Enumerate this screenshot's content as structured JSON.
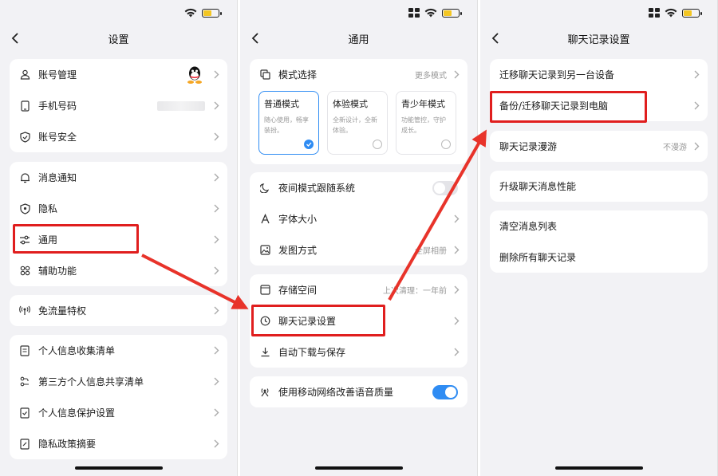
{
  "panel1": {
    "title": "设置",
    "group1": [
      {
        "label": "账号管理",
        "icon": "user-icon"
      },
      {
        "label": "手机号码",
        "icon": "phone-icon"
      },
      {
        "label": "账号安全",
        "icon": "shield-icon"
      }
    ],
    "group2": [
      {
        "label": "消息通知",
        "icon": "bell-icon"
      },
      {
        "label": "隐私",
        "icon": "privacy-icon"
      },
      {
        "label": "通用",
        "icon": "sliders-icon"
      },
      {
        "label": "辅助功能",
        "icon": "grid-icon"
      }
    ],
    "group3": [
      {
        "label": "免流量特权",
        "icon": "signal-icon"
      }
    ],
    "group4": [
      {
        "label": "个人信息收集清单",
        "icon": "document-icon"
      },
      {
        "label": "第三方个人信息共享清单",
        "icon": "share-icon"
      },
      {
        "label": "个人信息保护设置",
        "icon": "check-doc-icon"
      },
      {
        "label": "隐私政策摘要",
        "icon": "policy-icon"
      }
    ]
  },
  "panel2": {
    "title": "通用",
    "mode_select": "模式选择",
    "more_modes": "更多模式",
    "modes": [
      {
        "name": "普通模式",
        "desc": "随心使用，畅享装扮。",
        "selected": true
      },
      {
        "name": "体验模式",
        "desc": "全新设计，全新体验。",
        "selected": false
      },
      {
        "name": "青少年模式",
        "desc": "功能管控，守护成长。",
        "selected": false
      }
    ],
    "group2": [
      {
        "label": "夜间模式跟随系统",
        "icon": "moon-icon",
        "toggle": false
      },
      {
        "label": "字体大小",
        "icon": "font-icon",
        "value": ""
      },
      {
        "label": "发图方式",
        "icon": "image-icon",
        "value": "全屏相册"
      }
    ],
    "group3": [
      {
        "label": "存储空间",
        "icon": "storage-icon",
        "value": "上次清理：一年前"
      },
      {
        "label": "聊天记录设置",
        "icon": "clock-icon",
        "value": ""
      },
      {
        "label": "自动下载与保存",
        "icon": "download-icon",
        "value": ""
      }
    ],
    "group4": [
      {
        "label": "使用移动网络改善语音质量",
        "icon": "network-icon",
        "toggle": true
      }
    ]
  },
  "panel3": {
    "title": "聊天记录设置",
    "group1": [
      {
        "label": "迁移聊天记录到另一台设备"
      },
      {
        "label": "备份/迁移聊天记录到电脑"
      }
    ],
    "group2": [
      {
        "label": "聊天记录漫游",
        "value": "不漫游"
      }
    ],
    "group3": [
      {
        "label": "升级聊天消息性能"
      }
    ],
    "group4": [
      {
        "label": "清空消息列表"
      },
      {
        "label": "删除所有聊天记录"
      }
    ]
  },
  "colors": {
    "accent": "#2f8cf3",
    "highlight": "#e01e1e",
    "background": "#f2f2f5"
  }
}
